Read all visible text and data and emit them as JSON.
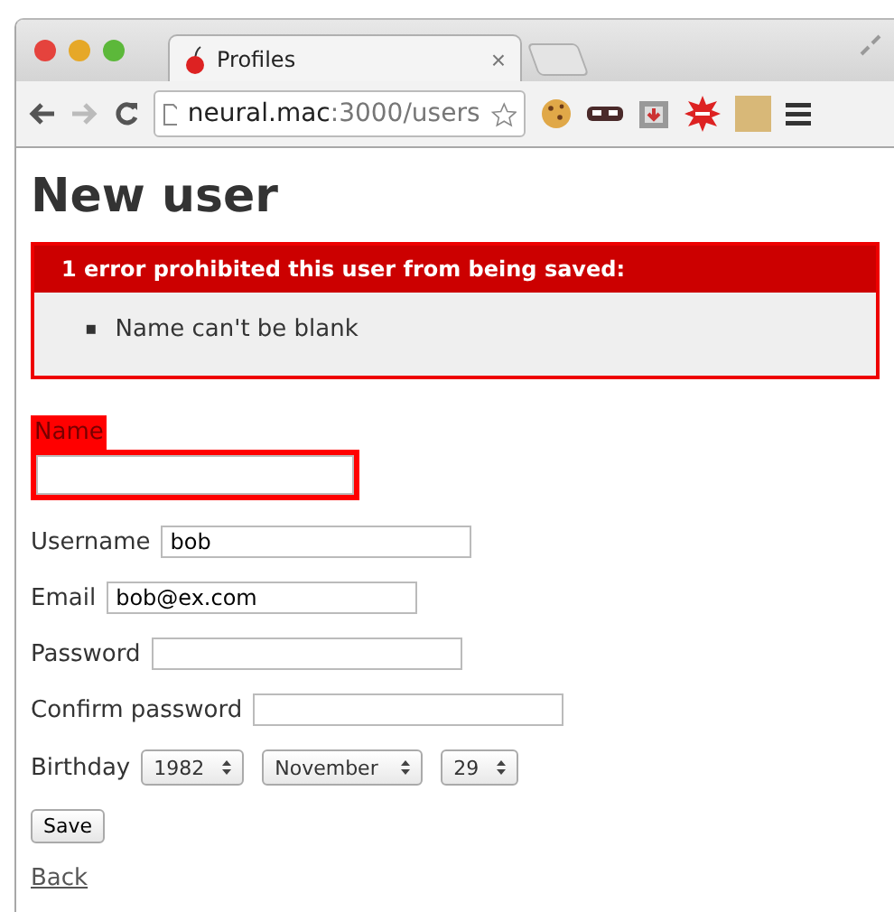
{
  "window": {
    "tab": {
      "title": "Profiles",
      "close": "×"
    }
  },
  "toolbar": {
    "url_host": "neural.mac",
    "url_path": ":3000/users"
  },
  "page": {
    "title": "New user",
    "error_box": {
      "header": "1 error prohibited this user from being saved:",
      "messages": [
        {
          "marker": "▪",
          "text": "Name can't be blank"
        }
      ]
    },
    "fields": [
      {
        "kind": "text",
        "label": "Name",
        "error": true
      },
      {
        "kind": "text",
        "label": "Username",
        "value": "bob",
        "error": false
      },
      {
        "kind": "text",
        "label": "Email",
        "value": "bob@ex.com",
        "error": false
      },
      {
        "kind": "text",
        "label": "Password",
        "error": false
      },
      {
        "kind": "text",
        "label": "Confirm password",
        "error": false
      },
      {
        "kind": "date",
        "label": "Birthday",
        "selects": [
          "1982",
          "November",
          "29"
        ],
        "error": false
      }
    ],
    "submit": "Save",
    "back_link": "Back"
  }
}
